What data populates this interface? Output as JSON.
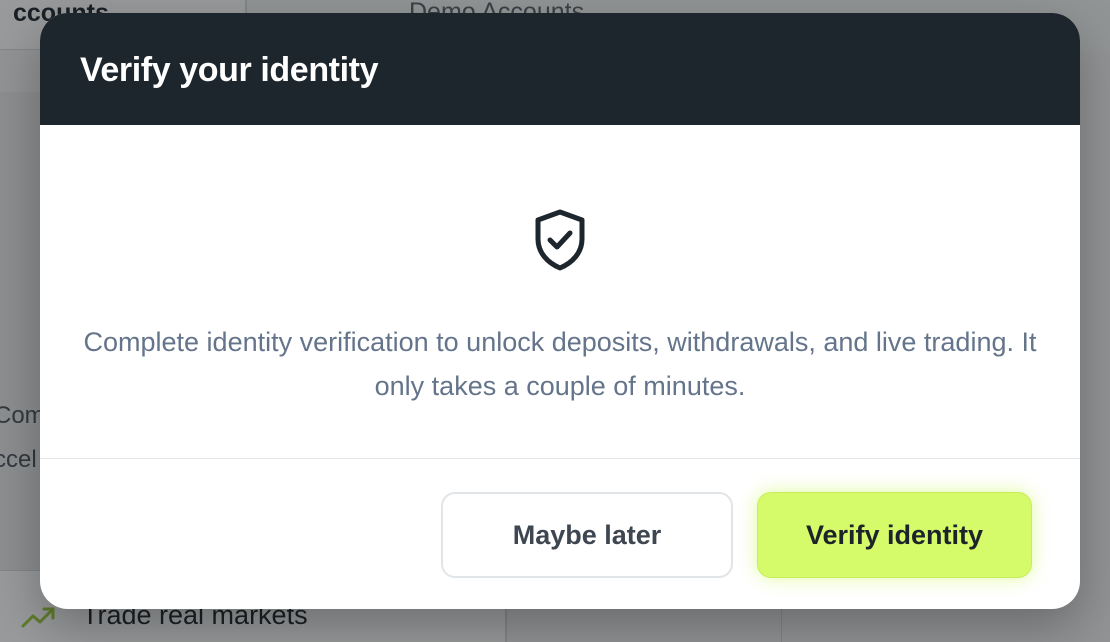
{
  "background": {
    "active_tab_label": "ccounts",
    "inactive_tab_label": "Demo Accounts",
    "side_text_1": "Com",
    "side_text_2": "ccel",
    "card_label": "Trade real markets"
  },
  "modal": {
    "title": "Verify your identity",
    "icon": "shield-check-icon",
    "message": "Complete identity verification to unlock deposits, withdrawals, and live trading. It only takes a couple of minutes.",
    "secondary_button_label": "Maybe later",
    "primary_button_label": "Verify identity"
  },
  "colors": {
    "header_bg": "#1d252d",
    "primary_button_bg": "#d6fb6a",
    "message_text": "#64748b"
  }
}
